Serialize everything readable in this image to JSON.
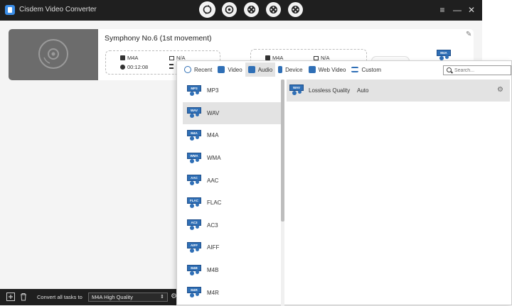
{
  "app": {
    "title": "Cisdem Video Converter",
    "mode_icons": [
      "convert-icon",
      "rip-icon",
      "film-reel-icon",
      "film-reel-icon",
      "film-reel-icon"
    ]
  },
  "task": {
    "title": "Symphony No.6 (1st movement)",
    "source": {
      "format": "M4A",
      "resolution": "N/A",
      "duration": "00:12:08"
    },
    "output": {
      "format": "M4A",
      "resolution": "N/A",
      "badge": "M4A"
    }
  },
  "bottombar": {
    "convert_all_label": "Convert all tasks to",
    "convert_all_value": "M4A High Quality"
  },
  "popup": {
    "tabs": [
      {
        "label": "Recent",
        "icon": "clock-icon"
      },
      {
        "label": "Video",
        "icon": "video-icon"
      },
      {
        "label": "Audio",
        "icon": "audio-icon",
        "active": true
      },
      {
        "label": "Device",
        "icon": "device-icon"
      },
      {
        "label": "Web Video",
        "icon": "web-video-icon"
      },
      {
        "label": "Custom",
        "icon": "custom-icon"
      }
    ],
    "search": {
      "placeholder": "Search..."
    },
    "formats": [
      {
        "label": "MP3",
        "tag": "MP3"
      },
      {
        "label": "WAV",
        "tag": "WAV",
        "selected": true
      },
      {
        "label": "M4A",
        "tag": "M4A"
      },
      {
        "label": "WMA",
        "tag": "WMA"
      },
      {
        "label": "AAC",
        "tag": "AAC"
      },
      {
        "label": "FLAC",
        "tag": "FLAC"
      },
      {
        "label": "AC3",
        "tag": "AC3"
      },
      {
        "label": "AIFF",
        "tag": "AIFF"
      },
      {
        "label": "M4B",
        "tag": "M4B"
      },
      {
        "label": "M4R",
        "tag": "M4R"
      }
    ],
    "detail": {
      "tag": "WAV",
      "quality": "Lossless Quality",
      "value": "Auto"
    }
  },
  "colors": {
    "accent": "#2f6fb6",
    "titlebar": "#1f1f1f",
    "selected_row": "#e3e3e3"
  }
}
